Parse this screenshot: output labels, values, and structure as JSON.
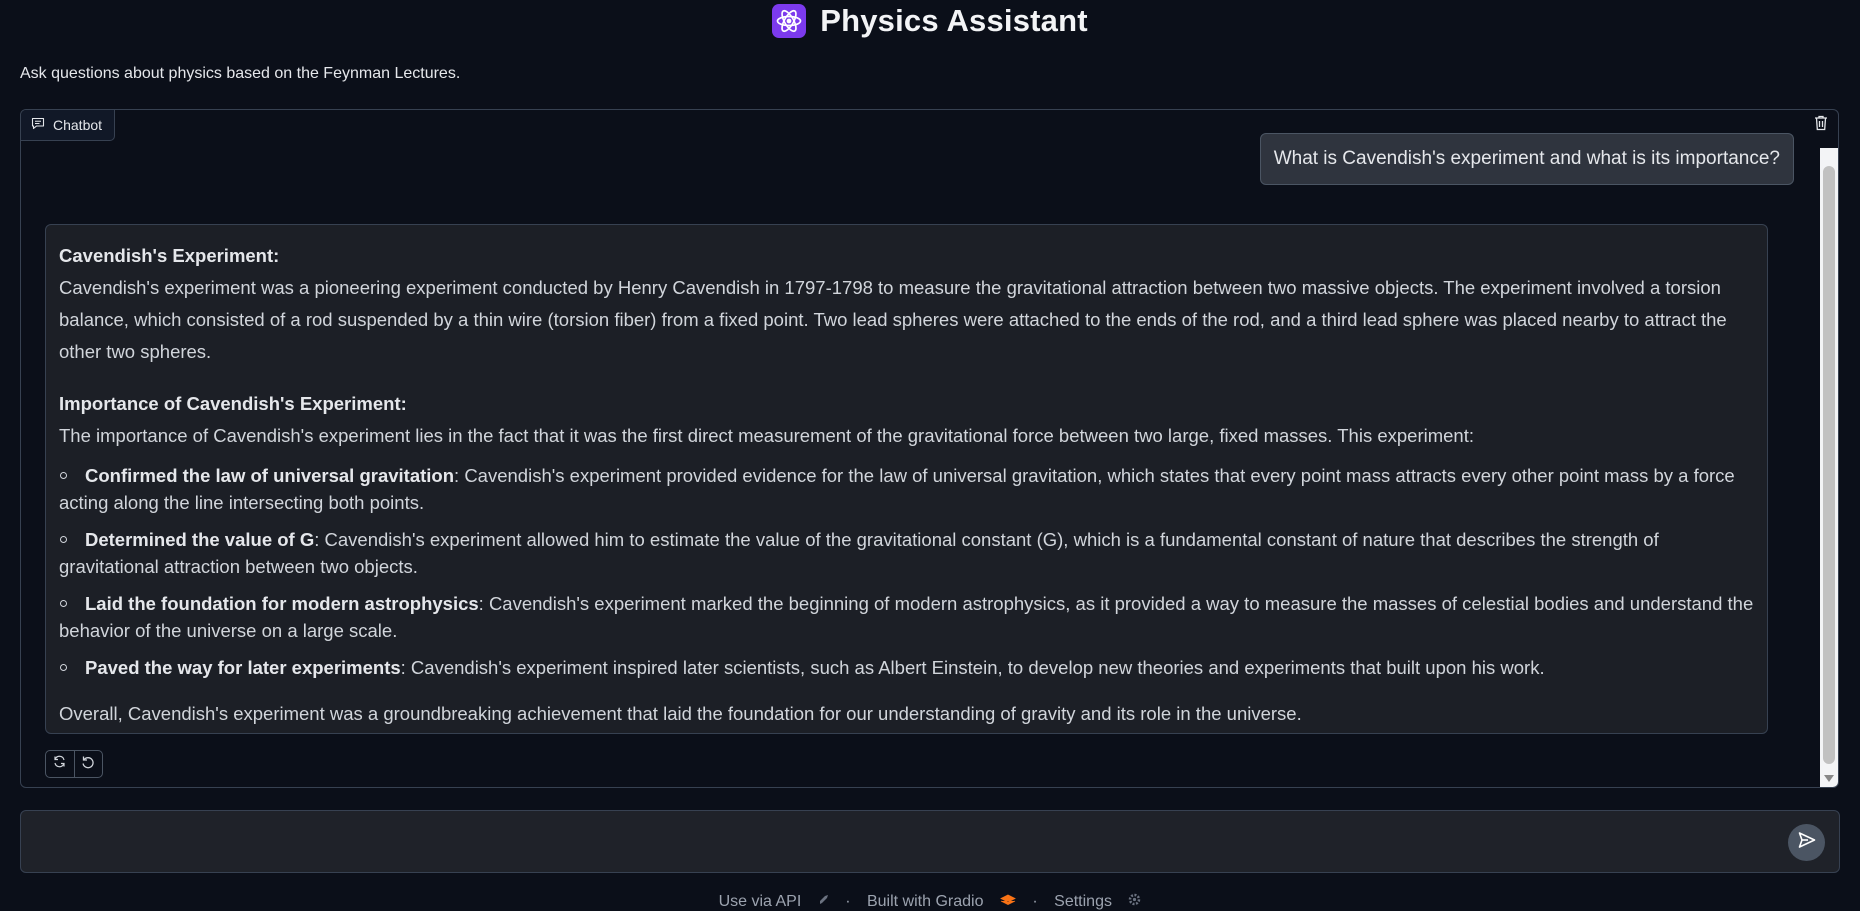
{
  "header": {
    "icon": "atom-icon",
    "title": "Physics Assistant",
    "subtitle": "Ask questions about physics based on the Feynman Lectures."
  },
  "chatbot": {
    "label": "Chatbot",
    "user_message": "What is Cavendish's experiment and what is its importance?",
    "bot": {
      "heading1": "Cavendish's Experiment:",
      "para1": "Cavendish's experiment was a pioneering experiment conducted by Henry Cavendish in 1797-1798 to measure the gravitational attraction between two massive objects. The experiment involved a torsion balance, which consisted of a rod suspended by a thin wire (torsion fiber) from a fixed point. Two lead spheres were attached to the ends of the rod, and a third lead sphere was placed nearby to attract the other two spheres.",
      "heading2": "Importance of Cavendish's Experiment:",
      "para2": "The importance of Cavendish's experiment lies in the fact that it was the first direct measurement of the gravitational force between two large, fixed masses. This experiment:",
      "bullets": [
        {
          "bold": "Confirmed the law of universal gravitation",
          "text": ": Cavendish's experiment provided evidence for the law of universal gravitation, which states that every point mass attracts every other point mass by a force acting along the line intersecting both points."
        },
        {
          "bold": "Determined the value of G",
          "text": ": Cavendish's experiment allowed him to estimate the value of the gravitational constant (G), which is a fundamental constant of nature that describes the strength of gravitational attraction between two objects."
        },
        {
          "bold": "Laid the foundation for modern astrophysics",
          "text": ": Cavendish's experiment marked the beginning of modern astrophysics, as it provided a way to measure the masses of celestial bodies and understand the behavior of the universe on a large scale."
        },
        {
          "bold": "Paved the way for later experiments",
          "text": ": Cavendish's experiment inspired later scientists, such as Albert Einstein, to develop new theories and experiments that built upon his work."
        }
      ],
      "overall": "Overall, Cavendish's experiment was a groundbreaking achievement that laid the foundation for our understanding of gravity and its role in the universe."
    }
  },
  "input": {
    "value": ""
  },
  "footer": {
    "api": "Use via API",
    "built": "Built with Gradio",
    "settings": "Settings",
    "sep": "·"
  }
}
